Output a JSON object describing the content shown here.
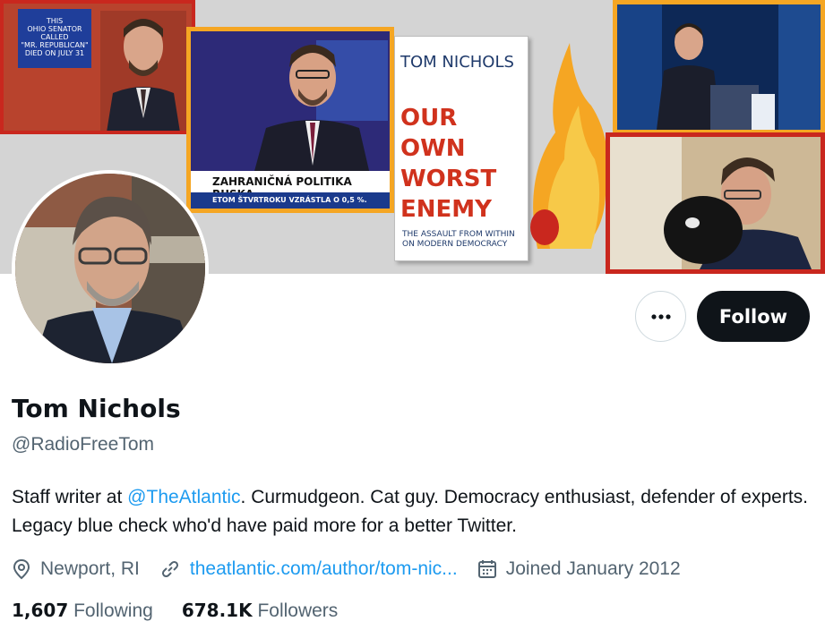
{
  "banner": {
    "tv1_caption": "THIS\nOHIO SENATOR\nCALLED\n\"MR. REPUBLICAN\"\nDIED ON JULY 31",
    "tv2_lower_third": "ZAHRANIČNÁ POLITIKA RUSKA",
    "tv2_ticker": "ETOM ŠTVRTROKU VZRÁSTLA O 0,5 %.",
    "book_author": "TOM NICHOLS",
    "book_title": "OUR OWN\nWORST\nENEMY",
    "book_subtitle": "THE ASSAULT FROM WITHIN\nON MODERN DEMOCRACY"
  },
  "profile": {
    "name": "Tom Nichols",
    "handle": "@RadioFreeTom",
    "bio_before": "Staff writer at ",
    "bio_mention": "@TheAtlantic",
    "bio_after": ". Curmudgeon. Cat guy. Democracy enthusiast, defender of experts. Legacy blue check who'd have paid more for a better Twitter.",
    "location": "Newport, RI",
    "website": "theatlantic.com/author/tom-nic...",
    "joined": "Joined January 2012",
    "following_count": "1,607",
    "following_label": "Following",
    "followers_count": "678.1K",
    "followers_label": "Followers"
  },
  "actions": {
    "follow_label": "Follow",
    "more_icon": "more-horizontal-icon"
  },
  "colors": {
    "accent": "#1d9bf0",
    "text_primary": "#0f1419",
    "text_secondary": "#536471",
    "follow_bg": "#0f1419"
  }
}
